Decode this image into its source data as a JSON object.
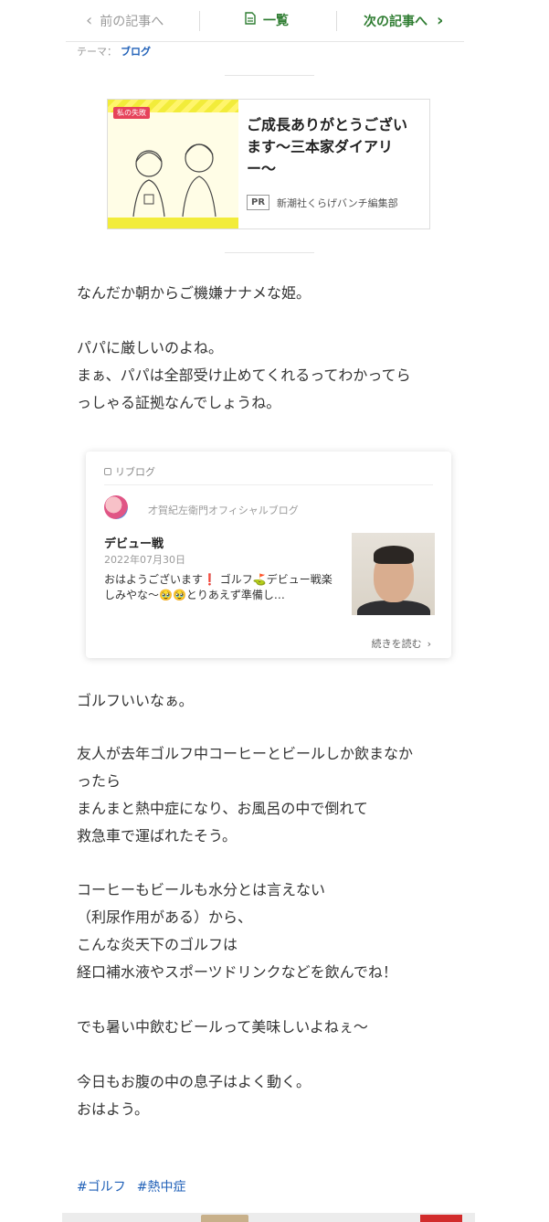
{
  "nav": {
    "prev_label": "前の記事へ",
    "list_label": "一覧",
    "next_label": "次の記事へ"
  },
  "theme": {
    "label": "テーマ：",
    "value": "ブログ"
  },
  "ad": {
    "image_tag": "私の失敗",
    "title": "ご成長ありがとうございます〜三本家ダイアリー〜",
    "pr_badge": "PR",
    "publisher": "新潮社くらげバンチ編集部"
  },
  "post": {
    "p1": "なんだか朝からご機嫌ナナメな姫。",
    "p2a": "パパに厳しいのよね。",
    "p2b": "まぁ、パパは全部受け止めてくれるってわかってら",
    "p2c": "っしゃる証拠なんでしょうね。",
    "p3": "ゴルフいいなぁ。",
    "p4a": "友人が去年ゴルフ中コーヒーとビールしか飲まなか",
    "p4b": "ったら",
    "p4c": "まんまと熱中症になり、お風呂の中で倒れて",
    "p4d": "救急車で運ばれたそう。",
    "p5a": "コーヒーもビールも水分とは言えない",
    "p5b": "（利尿作用がある）から、",
    "p5c": "こんな炎天下のゴルフは",
    "p5d": "経口補水液やスポーツドリンクなどを飲んでね！",
    "p6": "でも暑い中飲むビールって美味しいよねぇ〜",
    "p7a": "今日もお腹の中の息子はよく動く。",
    "p7b": "おはよう。"
  },
  "reblog": {
    "header": "リブログ",
    "blog_name": "才賀紀左衛門オフィシャルブログ",
    "title": "デビュー戦",
    "date": "2022年07月30日",
    "excerpt": "おはようございます❗️ ゴルフ⛳️デビュー戦楽しみやな〜🥹🥹とりあえず準備し…",
    "more": "続きを読む"
  },
  "hashtags": [
    "#ゴルフ",
    "#熱中症"
  ],
  "colors": {
    "accent_green": "#2f7d32",
    "link_blue": "#2161b8"
  },
  "icons": {
    "prev": "chevron-left-icon",
    "list": "document-icon",
    "next": "chevron-right-icon"
  }
}
